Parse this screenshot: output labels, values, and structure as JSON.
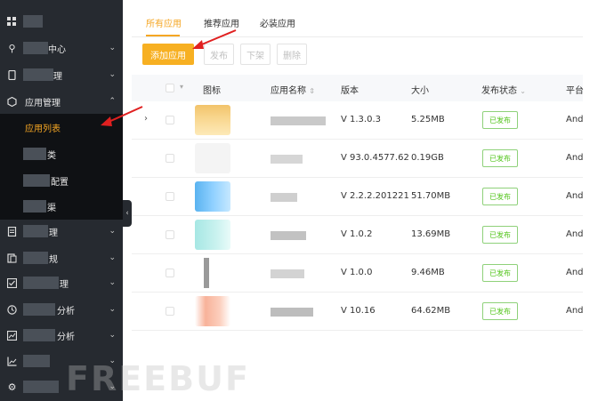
{
  "sidebar": {
    "items": [
      {
        "label": "",
        "mask_text": true
      },
      {
        "label": "中心"
      },
      {
        "label": "理"
      },
      {
        "label": "应用管理"
      },
      {
        "label": "应用列表"
      },
      {
        "label": "类"
      },
      {
        "label": "配置"
      },
      {
        "label": "渠"
      },
      {
        "label": "理"
      },
      {
        "label": "规"
      },
      {
        "label": "理"
      },
      {
        "label": "分析"
      },
      {
        "label": "分析"
      },
      {
        "label": ""
      },
      {
        "label": ""
      }
    ]
  },
  "tabs": [
    "所有应用",
    "推荐应用",
    "必装应用"
  ],
  "toolbar": {
    "add": "添加应用",
    "publish": "发布",
    "unpublish": "下架",
    "delete": "删除"
  },
  "table": {
    "headers": [
      "图标",
      "应用名称",
      "版本",
      "大小",
      "发布状态",
      "平台"
    ],
    "rows": [
      {
        "version": "V 1.3.0.3",
        "size": "5.25MB",
        "status": "已发布",
        "platform": "And"
      },
      {
        "version": "V 93.0.4577.62",
        "size": "0.19GB",
        "status": "已发布",
        "platform": "And"
      },
      {
        "version": "V 2.2.2.201221",
        "size": "51.70MB",
        "status": "已发布",
        "platform": "And"
      },
      {
        "version": "V 1.0.2",
        "size": "13.69MB",
        "status": "已发布",
        "platform": "And"
      },
      {
        "version": "V 1.0.0",
        "size": "9.46MB",
        "status": "已发布",
        "platform": "And"
      },
      {
        "version": "V 10.16",
        "size": "64.62MB",
        "status": "已发布",
        "platform": "And"
      }
    ]
  },
  "watermark": "FREEBUF",
  "colors": {
    "accent": "#f5a623",
    "sidebar": "#262a30",
    "success": "#52c41a",
    "annotation": "#e02020"
  }
}
